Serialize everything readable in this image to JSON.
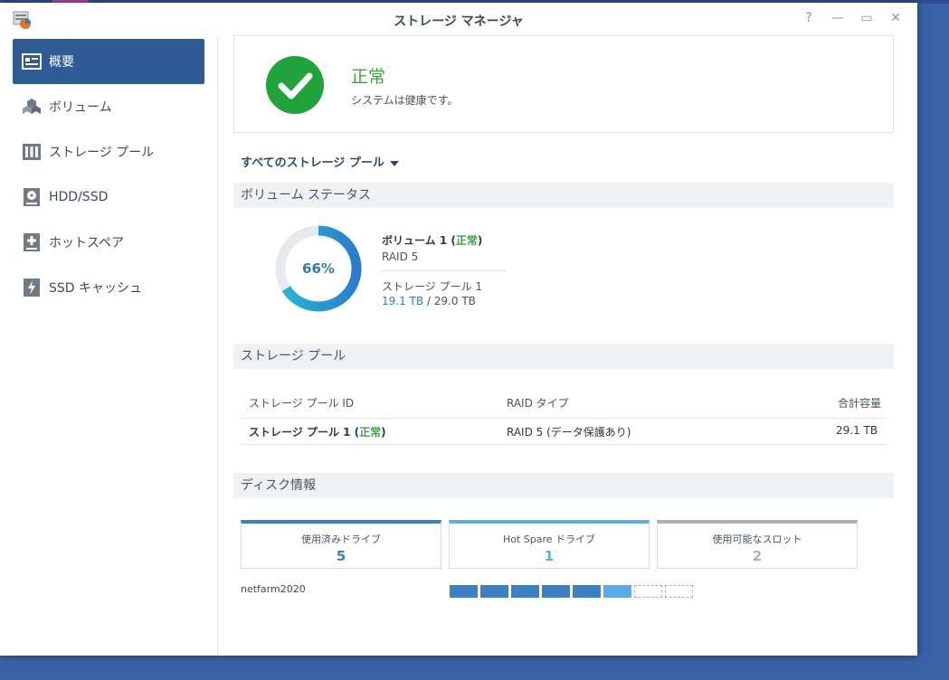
{
  "window": {
    "title": "ストレージ マネージャ",
    "help": "?",
    "minimize": "—",
    "maximize": "▭",
    "close": "✕"
  },
  "sidebar": {
    "items": [
      {
        "label": "概要",
        "icon": "overview-icon",
        "active": true
      },
      {
        "label": "ボリューム",
        "icon": "volume-icon"
      },
      {
        "label": "ストレージ プール",
        "icon": "storage-pool-icon"
      },
      {
        "label": "HDD/SSD",
        "icon": "hdd-icon"
      },
      {
        "label": "ホットスペア",
        "icon": "hot-spare-icon"
      },
      {
        "label": "SSD キャッシュ",
        "icon": "ssd-cache-icon"
      }
    ]
  },
  "status": {
    "title": "正常",
    "message": "システムは健康です。"
  },
  "pool_filter": {
    "label": "すべてのストレージ プール"
  },
  "volume_status": {
    "header": "ボリューム ステータス",
    "usage_percent": 66,
    "usage_label": "66%",
    "name": "ボリューム 1",
    "state": "正常",
    "raid": "RAID 5",
    "pool": "ストレージ プール 1",
    "used": "19.1 TB",
    "total": "29.0 TB"
  },
  "storage_pool": {
    "header": "ストレージ プール",
    "columns": {
      "id": "ストレージ プール ID",
      "raid": "RAID タイプ",
      "capacity": "合計容量"
    },
    "rows": [
      {
        "name": "ストレージ プール 1",
        "state": "正常",
        "raid": "RAID 5 (データ保護あり)",
        "capacity": "29.1 TB"
      }
    ]
  },
  "disk_info": {
    "header": "ディスク情報",
    "cards": [
      {
        "label": "使用済みドライブ",
        "value": "5",
        "color": "#3b7fc4"
      },
      {
        "label": "Hot Spare ドライブ",
        "value": "1",
        "color": "#5aaee8"
      },
      {
        "label": "使用可能なスロット",
        "value": "2",
        "color": "#a7b2bc"
      }
    ],
    "host": "netfarm2020",
    "slots": [
      "used",
      "used",
      "used",
      "used",
      "used",
      "spare",
      "empty",
      "empty"
    ]
  },
  "colors": {
    "accent": "#2f5b97",
    "ok": "#3ea33a",
    "used": "#3b7fc4",
    "spare": "#5aaee8"
  }
}
